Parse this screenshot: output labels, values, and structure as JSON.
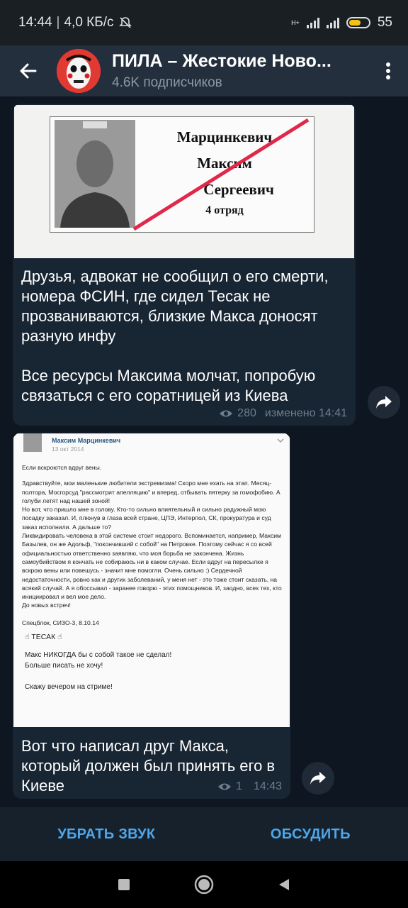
{
  "status": {
    "time": "14:44",
    "speed": "4,0 КБ/с",
    "network": "H+",
    "battery": "55"
  },
  "header": {
    "title": "ПИЛА – Жестокие Ново...",
    "subtitle": "4.6K подписчиков"
  },
  "message1": {
    "card": {
      "surname": "Марцинкевич",
      "name": "Максим",
      "patronymic": "Сергеевич",
      "unit": "4 отряд"
    },
    "text": "Друзья, адвокат не сообщил о его смерти, номера ФСИН, где сидел Тесак не прозваниваются,  близкие Макса доносят разную инфу\n\nВсе ресурсы Максима молчат, попробую связаться с его соратницей из Киева",
    "views": "280",
    "edited": "изменено 14:41"
  },
  "message2": {
    "post": {
      "author": "Максим Марцинкевич",
      "date": "13 окт 2014",
      "heading": "Если вскроются вдруг вены.",
      "body": "Здравствуйте, мои маленькие любители экстремизма! Скоро мне ехать на этап. Месяц-полтора, Мосгорсуд \"рассмотрит апелляцию\" и вперед, отбывать пятерку за гомофобию. А голуби летят над нашей зоной!\nНо вот, что пришло мне в голову. Кто-то сильно влиятельный и сильно радужный мою посадку заказал. И, плюнув в глаза всей стране, ЦПЭ, Интерпол, СК, прокуратура и суд заказ исполнили. А дальше то?\nЛиквидировать человека в этой системе стоит недорого. Вспоминается, например, Максим Базылев, он же Адольф, \"покончивший с собой\" на Петровке. Поэтому сейчас я со всей официальностью ответственно заявляю, что моя борьба не закончена. Жизнь самоубийством я кончать не собираюсь ни в каком случае. Если вдруг на пересылке я вскрою вены или повешусь - значит мне помогли. Очень сильно :) Сердечной недостаточности, ровно как и других заболеваний, у меня нет - это тоже стоит сказать, на всякий случай. А я обоссывал - заранее говорю - этих помощников. И, заодно, всех тех, кто инициировал и вел мое дело.\nДо новых встреч!",
      "signature": "Спецблок, СИЗО-3, 8.10.14",
      "tag": "ТЕСАК",
      "extra1": "Макс НИКОГДА бы с собой такое не сделал!",
      "extra2": "Больше писать не хочу!",
      "extra3": "Скажу вечером на стриме!"
    },
    "text": "Вот что написал друг Макса, который должен был принять его в Киеве",
    "views": "1",
    "time": "14:43"
  },
  "bottom": {
    "mute": "УБРАТЬ ЗВУК",
    "discuss": "ОБСУДИТЬ"
  },
  "icons": {
    "back": "arrow-left-icon",
    "menu": "more-vertical-icon",
    "views": "eye-icon",
    "share": "share-arrow-icon",
    "nav_recent": "square-icon",
    "nav_home": "circle-icon",
    "nav_back": "triangle-icon"
  },
  "colors": {
    "background": "#0e1621",
    "bubble": "#182533",
    "header": "#242f3d",
    "accent": "#4ca7ed",
    "stamp_red": "#e0284a"
  }
}
